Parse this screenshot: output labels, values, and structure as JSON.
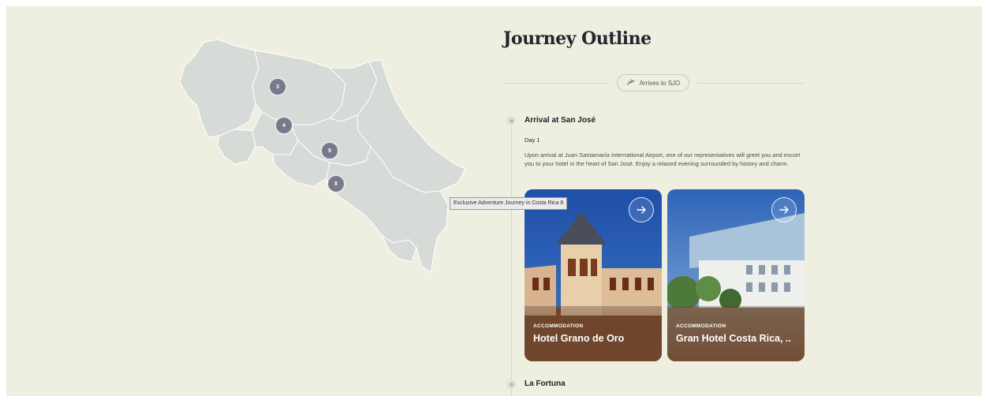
{
  "map": {
    "pins": [
      {
        "label": "3"
      },
      {
        "label": "4"
      },
      {
        "label": "9"
      },
      {
        "label": "8"
      }
    ],
    "tooltip": "Exclusive Adventure Journey in Costa Rica 8"
  },
  "journey": {
    "title": "Journey Outline",
    "arrival_badge": {
      "icon": "plane-icon",
      "label": "Arrives to SJO"
    },
    "stops": [
      {
        "title": "Arrival at San José",
        "day": "Day 1",
        "description": "Upon arrival at Juan Santamaría International Airport, one of our representatives will greet you and escort you to your hotel in the heart of San José. Enjoy a relaxed evening surrounded by history and charm.",
        "cards": [
          {
            "kicker": "ACCOMMODATION",
            "name": "Hotel Grano de Oro",
            "icon": "arrow-right-icon"
          },
          {
            "kicker": "ACCOMMODATION",
            "name": "Gran Hotel Costa Rica, ..",
            "icon": "arrow-right-icon"
          }
        ]
      },
      {
        "title": "La Fortuna"
      }
    ]
  },
  "colors": {
    "background": "#efefe1",
    "map_fill": "#d6dbd8",
    "pin": "#787a8c",
    "title": "#25252d"
  }
}
